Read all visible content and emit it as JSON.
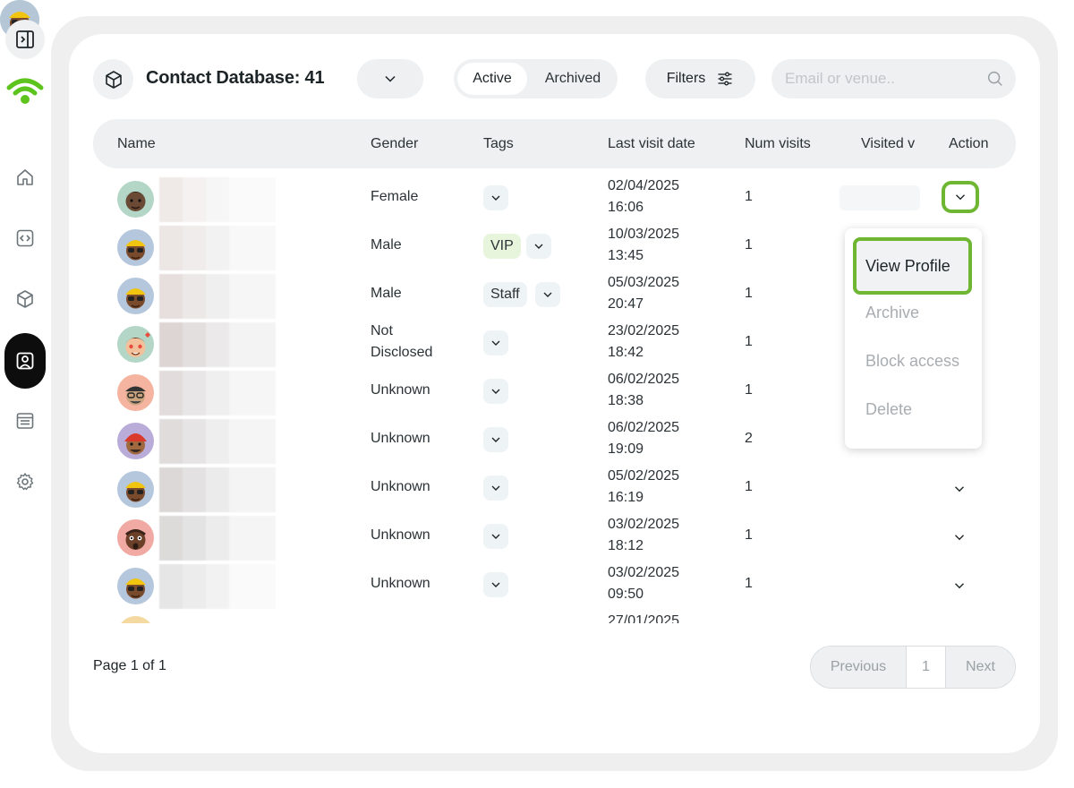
{
  "header": {
    "title": "Contact Database: 41",
    "segments": {
      "active": "Active",
      "archived": "Archived"
    },
    "filters_label": "Filters",
    "search_placeholder": "Email or venue.."
  },
  "table": {
    "columns": [
      "Name",
      "Gender",
      "Tags",
      "Last visit date",
      "Num visits",
      "Visited v",
      "Action"
    ],
    "rows": [
      {
        "gender": "Female",
        "tag": "",
        "date": "02/04/2025",
        "time": "16:06",
        "visits": "1",
        "avatar_color": "#b3d6c6"
      },
      {
        "gender": "Male",
        "tag": "VIP",
        "date": "10/03/2025",
        "time": "13:45",
        "visits": "1",
        "avatar_color": "#b5c7dd"
      },
      {
        "gender": "Male",
        "tag": "Staff",
        "date": "05/03/2025",
        "time": "20:47",
        "visits": "1",
        "avatar_color": "#b5c7dd"
      },
      {
        "gender": "Not",
        "gender2": "Disclosed",
        "tag": "",
        "date": "23/02/2025",
        "time": "18:42",
        "visits": "1",
        "avatar_color": "#b3d6c6"
      },
      {
        "gender": "Unknown",
        "tag": "",
        "date": "06/02/2025",
        "time": "18:38",
        "visits": "1",
        "avatar_color": "#f4b4a0"
      },
      {
        "gender": "Unknown",
        "tag": "",
        "date": "06/02/2025",
        "time": "19:09",
        "visits": "2",
        "avatar_color": "#b9acd9"
      },
      {
        "gender": "Unknown",
        "tag": "",
        "date": "05/02/2025",
        "time": "16:19",
        "visits": "1",
        "avatar_color": "#b5c7dd"
      },
      {
        "gender": "Unknown",
        "tag": "",
        "date": "03/02/2025",
        "time": "18:12",
        "visits": "1",
        "avatar_color": "#f1a9a3"
      },
      {
        "gender": "Unknown",
        "tag": "",
        "date": "03/02/2025",
        "time": "09:50",
        "visits": "1",
        "avatar_color": "#b5c7dd"
      },
      {
        "gender": "",
        "tag": "",
        "date": "27/01/2025",
        "time": "",
        "visits": "",
        "avatar_color": "#f4d9a0"
      }
    ]
  },
  "menu": {
    "items": [
      "View Profile",
      "Archive",
      "Block access",
      "Delete"
    ]
  },
  "footer": {
    "page_info": "Page 1 of 1",
    "previous": "Previous",
    "page_number": "1",
    "next": "Next"
  },
  "colors": {
    "accent_green": "#6fb732",
    "logo_green": "#5cc41c"
  }
}
